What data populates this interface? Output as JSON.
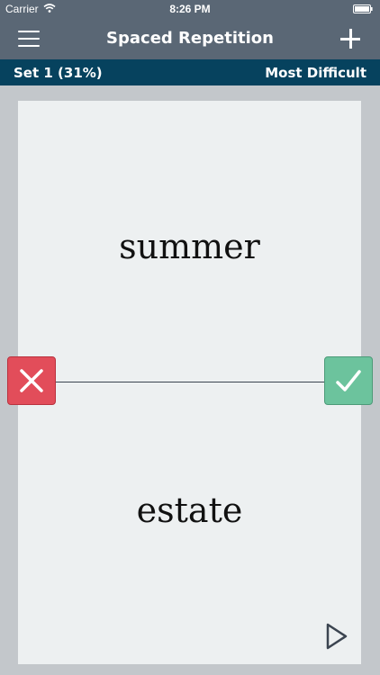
{
  "status_bar": {
    "carrier": "Carrier",
    "time": "8:26 PM",
    "icons": [
      "wifi-icon",
      "battery-icon"
    ]
  },
  "nav": {
    "title": "Spaced Repetition",
    "left_icon": "menu-icon",
    "right_icon": "add-icon"
  },
  "set_bar": {
    "set_label": "Set 1 (31%)",
    "difficulty_label": "Most Difficult"
  },
  "card": {
    "front_text": "summer",
    "back_text": "estate"
  },
  "controls": {
    "wrong_icon": "x-icon",
    "right_icon": "checkmark-icon",
    "play_icon": "play-icon"
  },
  "colors": {
    "nav_bg": "#5a6775",
    "set_bar_bg": "#06425e",
    "background": "#c3c7cb",
    "card_bg": "#edf0f1",
    "wrong": "#e24d5a",
    "right": "#6cc39d"
  }
}
